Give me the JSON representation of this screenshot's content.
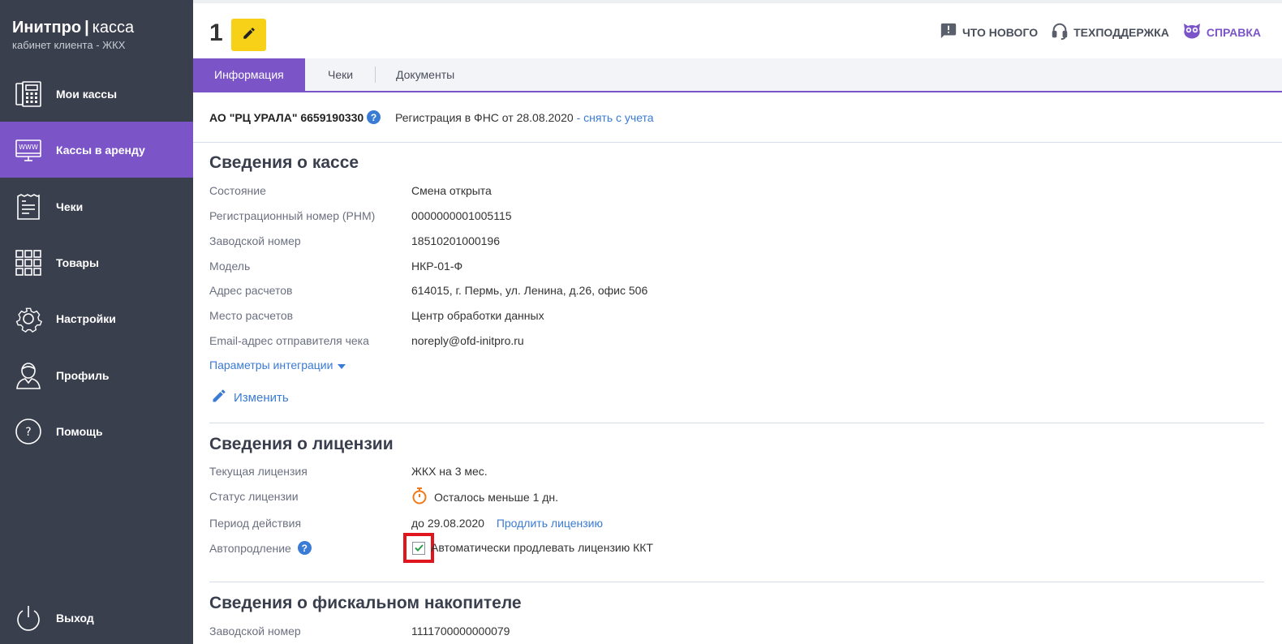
{
  "brand": {
    "name_bold": "Инитпро",
    "separator": "|",
    "name_light": "касса",
    "subtitle": "кабинет клиента - ЖКХ"
  },
  "sidebar": {
    "items": [
      {
        "label": "Мои кассы",
        "icon": "cash-register-icon"
      },
      {
        "label": "Кассы в аренду",
        "icon": "www-monitor-icon",
        "active": true
      },
      {
        "label": "Чеки",
        "icon": "receipt-icon"
      },
      {
        "label": "Товары",
        "icon": "grid-icon"
      },
      {
        "label": "Настройки",
        "icon": "gear-icon"
      },
      {
        "label": "Профиль",
        "icon": "user-icon"
      },
      {
        "label": "Помощь",
        "icon": "help-circle-icon"
      }
    ],
    "logout": {
      "label": "Выход",
      "icon": "power-icon"
    }
  },
  "header": {
    "kassa_number": "1",
    "links": [
      {
        "label": "ЧТО НОВОГО",
        "icon": "message-alert-icon"
      },
      {
        "label": "ТЕХПОДДЕРЖКА",
        "icon": "headset-icon"
      },
      {
        "label": "СПРАВКА",
        "icon": "owl-icon"
      }
    ]
  },
  "tabs": [
    "Информация",
    "Чеки",
    "Документы"
  ],
  "org": {
    "name": "АО \"РЦ УРАЛА\" 6659190330",
    "registration": "Регистрация в ФНС от 28.08.2020",
    "unregister_link": "- снять с учета"
  },
  "kassa_info": {
    "title": "Сведения о кассе",
    "rows": [
      {
        "label": "Состояние",
        "value": "Смена открыта"
      },
      {
        "label": "Регистрационный номер (РНМ)",
        "value": "0000000001005115"
      },
      {
        "label": "Заводской номер",
        "value": "18510201000196"
      },
      {
        "label": "Модель",
        "value": "НКР-01-Ф"
      },
      {
        "label": "Адрес расчетов",
        "value": "614015, г. Пермь, ул. Ленина, д.26, офис 506"
      },
      {
        "label": "Место расчетов",
        "value": "Центр обработки данных"
      },
      {
        "label": "Email-адрес отправителя чека",
        "value": "noreply@ofd-initpro.ru"
      }
    ],
    "integration_link": "Параметры интеграции",
    "edit_link": "Изменить"
  },
  "license_info": {
    "title": "Сведения о лицензии",
    "current_label": "Текущая лицензия",
    "current_value": "ЖКХ на 3 мес.",
    "status_label": "Статус лицензии",
    "status_value": "Осталось меньше 1 дн.",
    "period_label": "Период действия",
    "period_value": "до 29.08.2020",
    "renew_link": "Продлить лицензию",
    "autorenew_label": "Автопродление",
    "autorenew_text": "Автоматически продлевать лицензию ККТ",
    "autorenew_checked": true
  },
  "fiscal_info": {
    "title": "Сведения о фискальном накопителе",
    "serial_label": "Заводской номер",
    "serial_value": "1111700000000079"
  },
  "colors": {
    "sidebar_bg": "#3a3f4e",
    "accent": "#7b55c7",
    "edit_button": "#f7d117",
    "link": "#3a7bd5",
    "highlight": "#e0161e",
    "timer": "#f07a1a"
  }
}
